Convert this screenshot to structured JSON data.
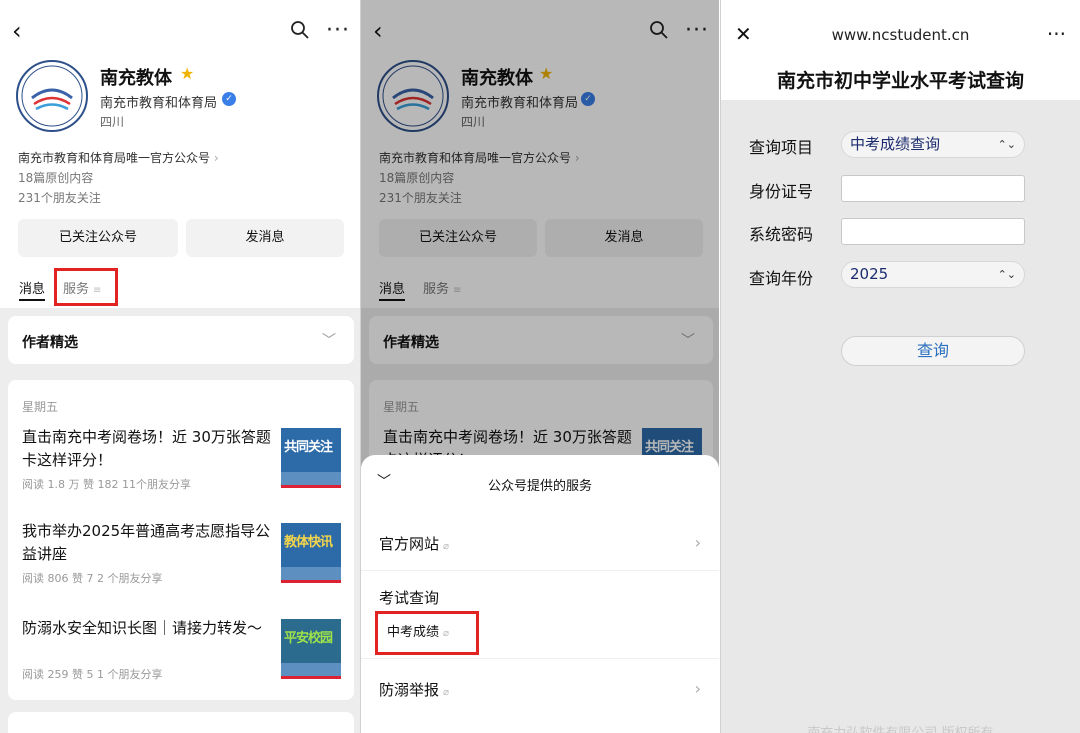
{
  "account": {
    "name": "南充教体",
    "org": "南充市教育和体育局",
    "location": "四川",
    "desc": "南充市教育和体育局唯一官方公众号",
    "articles_count": "18篇原创内容",
    "followers": "231个朋友关注",
    "follow_button": "已关注公众号",
    "message_button": "发消息"
  },
  "tabs": {
    "messages": "消息",
    "services": "服务"
  },
  "featured": {
    "title": "作者精选"
  },
  "feed": {
    "day": "星期五",
    "articles": [
      {
        "title": "直击南充中考阅卷场！近 30万张答题卡这样评分！",
        "meta": "阅读 1.8 万  赞 182  11个朋友分享",
        "thumb": "共同关注",
        "thumb_color": "#ffffff"
      },
      {
        "title": "我市举办2025年普通高考志愿指导公益讲座",
        "meta": "阅读 806  赞 7  2 个朋友分享",
        "thumb": "教体快讯",
        "thumb_color": "#f5d64a"
      },
      {
        "title": "防溺水安全知识长图｜请接力转发～",
        "meta": "阅读 259  赞 5  1 个朋友分享",
        "thumb": "平安校园",
        "thumb_color": "#9fe24a"
      }
    ]
  },
  "services_sheet": {
    "title": "公众号提供的服务",
    "official_site": "官方网站",
    "exam_section": "考试查询",
    "exam_item": "中考成绩",
    "drowning_report": "防溺举报"
  },
  "query_page": {
    "url": "www.ncstudent.cn",
    "title": "南充市初中学业水平考试查询",
    "labels": {
      "item": "查询项目",
      "id_card": "身份证号",
      "password": "系统密码",
      "year": "查询年份"
    },
    "item_value": "中考成绩查询",
    "year_value": "2025",
    "submit": "查询",
    "footer": "南充力弘软件有限公司 版权所有"
  },
  "icons": [
    "back-icon",
    "search-icon",
    "more-icon",
    "star-icon",
    "verified-icon",
    "chevron-down-icon",
    "chevron-right-icon",
    "link-icon",
    "close-icon",
    "select-caret-icon"
  ]
}
